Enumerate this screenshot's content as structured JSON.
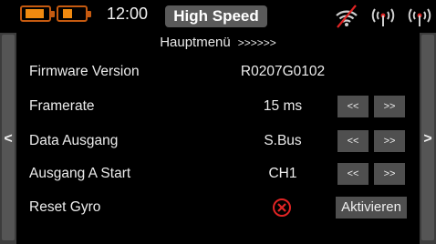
{
  "status": {
    "time": "12:00",
    "mode": "High Speed",
    "icons": [
      "battery-icon",
      "battery-icon",
      "wifi-icon",
      "antenna-icon",
      "antenna-icon"
    ],
    "battery_color": "#f08a10"
  },
  "menu": {
    "title": "Hauptmenü",
    "chevrons": ">>>>>>"
  },
  "nav": {
    "left_arrow": "<",
    "right_arrow": ">"
  },
  "rows": [
    {
      "label": "Firmware Version",
      "value": "R0207G0102"
    },
    {
      "label": "Framerate",
      "value": "15 ms",
      "dec": "<<",
      "inc": ">>"
    },
    {
      "label": "Data Ausgang",
      "value": "S.Bus",
      "dec": "<<",
      "inc": ">>"
    },
    {
      "label": "Ausgang A Start",
      "value": "CH1",
      "dec": "<<",
      "inc": ">>"
    },
    {
      "label": "Reset Gyro",
      "status_icon": "error-x-icon",
      "action": "Aktivieren"
    }
  ],
  "colors": {
    "background": "#000000",
    "button": "#4f4f4f",
    "side_panel": "#3c3c3c",
    "error_red": "#e02424"
  }
}
